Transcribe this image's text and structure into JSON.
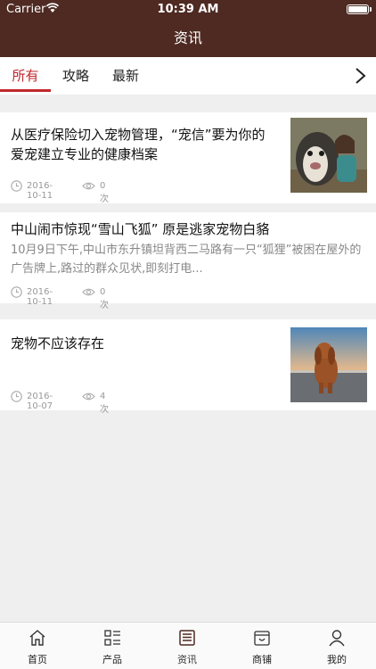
{
  "status": {
    "carrier": "Carrier",
    "time": "10:39 AM"
  },
  "nav": {
    "title": "资讯"
  },
  "tabs": [
    {
      "label": "所有",
      "active": true
    },
    {
      "label": "攻略",
      "active": false
    },
    {
      "label": "最新",
      "active": false
    }
  ],
  "articles": [
    {
      "title": "从医疗保险切入宠物管理，“宠信”要为你的爱宠建立专业的健康档案",
      "date": "2016-10-11",
      "views": "0次"
    },
    {
      "title": "中山闹市惊现“雪山飞狐” 原是逃家宠物白貉",
      "summary": "10月9日下午,中山市东升镇坦背西二马路有一只“狐狸”被困在屋外的广告牌上,路过的群众见状,即刻打电...",
      "date": "2016-10-11",
      "views": "0次"
    },
    {
      "title": "宠物不应该存在",
      "date": "2016-10-07",
      "views": "4次"
    }
  ],
  "tabbar": [
    {
      "label": "首页",
      "icon": "home-icon"
    },
    {
      "label": "产品",
      "icon": "grid-list-icon"
    },
    {
      "label": "资讯",
      "icon": "news-icon",
      "active": true
    },
    {
      "label": "商铺",
      "icon": "shop-icon"
    },
    {
      "label": "我的",
      "icon": "user-icon"
    }
  ],
  "colors": {
    "brand": "#4e2a22",
    "accent": "#c0282d"
  }
}
